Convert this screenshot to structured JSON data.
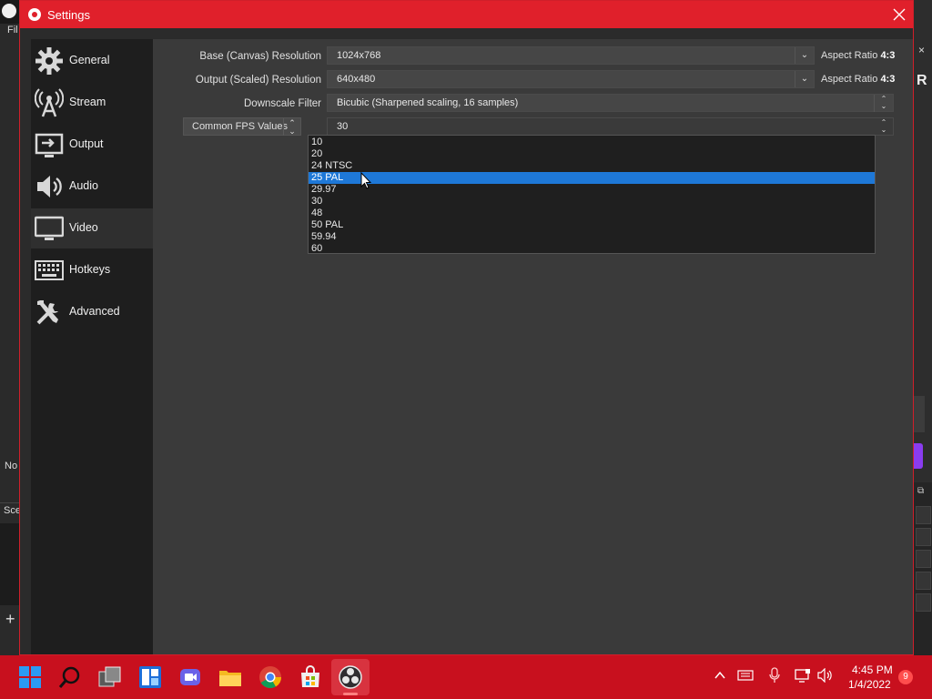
{
  "background": {
    "menu_fragment": "Fil",
    "no_fragment": "No",
    "scene_fragment": "Sce",
    "plus": "+",
    "right_x": "×",
    "right_r": "R"
  },
  "dialog": {
    "title": "Settings",
    "close_icon": "close-icon"
  },
  "sidebar": {
    "items": [
      {
        "label": "General",
        "icon": "gear-icon"
      },
      {
        "label": "Stream",
        "icon": "broadcast-icon"
      },
      {
        "label": "Output",
        "icon": "output-icon"
      },
      {
        "label": "Audio",
        "icon": "speaker-icon"
      },
      {
        "label": "Video",
        "icon": "monitor-icon",
        "active": true
      },
      {
        "label": "Hotkeys",
        "icon": "keyboard-icon"
      },
      {
        "label": "Advanced",
        "icon": "tools-icon"
      }
    ]
  },
  "video": {
    "base_label": "Base (Canvas) Resolution",
    "base_value": "1024x768",
    "base_aspect_prefix": "Aspect Ratio",
    "base_aspect_value": "4:3",
    "output_label": "Output (Scaled) Resolution",
    "output_value": "640x480",
    "output_aspect_prefix": "Aspect Ratio",
    "output_aspect_value": "4:3",
    "downscale_label": "Downscale Filter",
    "downscale_value": "Bicubic (Sharpened scaling, 16 samples)",
    "fps_type": "Common FPS Values",
    "fps_value": "30",
    "fps_options": [
      "10",
      "20",
      "24 NTSC",
      "25 PAL",
      "29.97",
      "30",
      "48",
      "50 PAL",
      "59.94",
      "60"
    ],
    "fps_selected_index": 3
  },
  "taskbar": {
    "icons": [
      "windows-start-icon",
      "search-icon",
      "task-view-icon",
      "widgets-icon",
      "teams-chat-icon",
      "file-explorer-icon",
      "chrome-icon",
      "store-icon",
      "obs-icon"
    ],
    "time": "4:45 PM",
    "date": "1/4/2022",
    "notification_count": "9"
  }
}
